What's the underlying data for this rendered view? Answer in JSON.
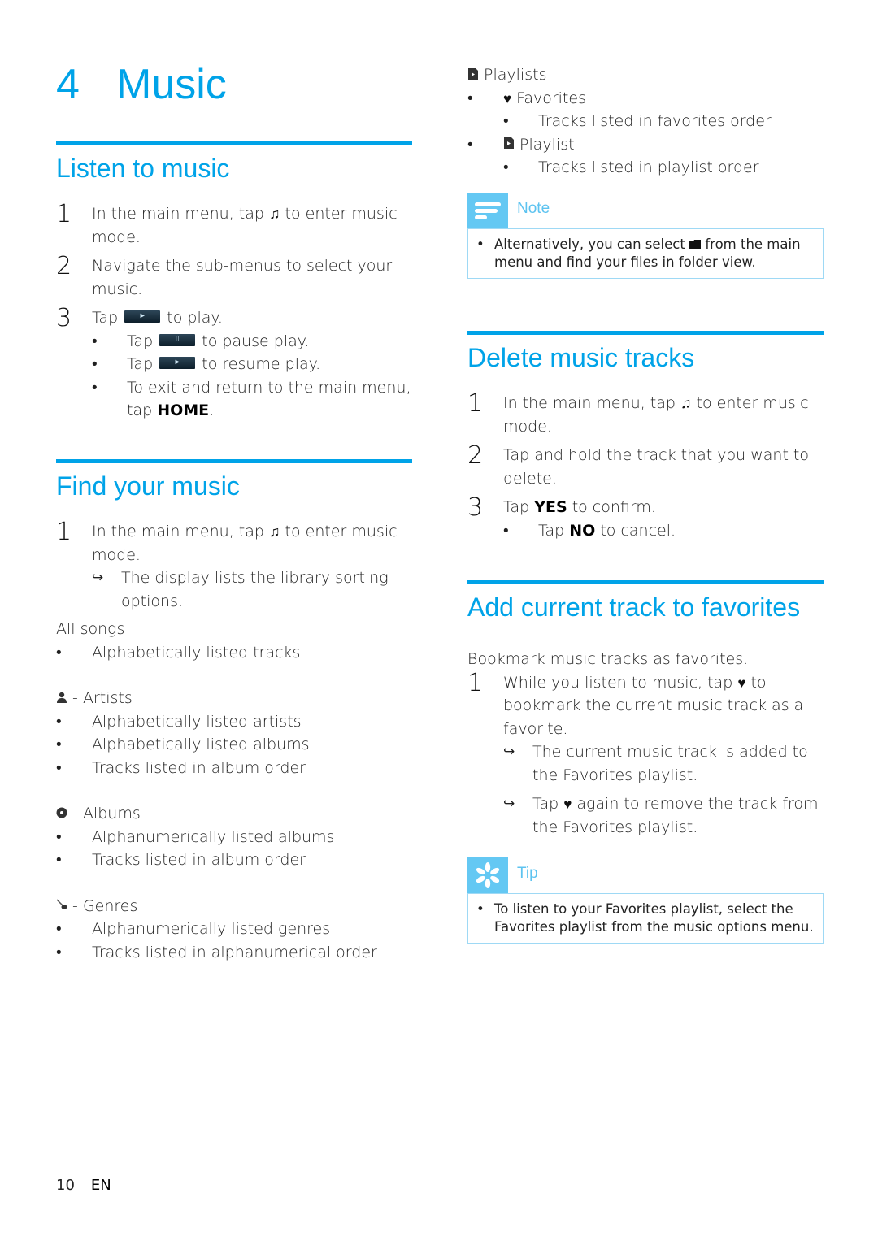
{
  "chapter": {
    "number": "4",
    "title": "Music"
  },
  "listen": {
    "heading": "Listen to music",
    "steps": [
      {
        "num": "1",
        "text_before": "In the main menu, tap",
        "text_after": "to enter music mode."
      },
      {
        "num": "2",
        "text": "Navigate the sub-menus to select your music."
      },
      {
        "num": "3",
        "text_before": "Tap",
        "text_after": "to play."
      }
    ],
    "bullets": [
      {
        "before": "Tap",
        "after": "to pause play."
      },
      {
        "before": "Tap",
        "after": "to resume play."
      },
      {
        "before": "To exit and return to the main menu, tap",
        "bold": "HOME",
        "after": "."
      }
    ]
  },
  "find": {
    "heading": "Find your music",
    "step1": {
      "num": "1",
      "text_before": "In the main menu, tap",
      "text_after": "to enter music mode."
    },
    "result": "The display lists the library sorting options.",
    "groups": [
      {
        "title": "All songs",
        "items": [
          "Alphabetically listed tracks"
        ]
      },
      {
        "title": "- Artists",
        "icon": "artist-icon",
        "items": [
          "Alphabetically listed artists",
          "Alphabetically listed albums",
          "Tracks listed in album order"
        ]
      },
      {
        "title": "- Albums",
        "icon": "album-icon",
        "items": [
          "Alphanumerically listed albums",
          "Tracks listed in album order"
        ]
      },
      {
        "title": "- Genres",
        "icon": "genre-icon",
        "items": [
          "Alphanumerically listed genres",
          "Tracks listed in alphanumerical order"
        ]
      }
    ]
  },
  "playlists": {
    "title": "Playlists",
    "favorites": {
      "label": "Favorites",
      "sub": "Tracks listed in favorites order"
    },
    "playlist": {
      "label": "Playlist",
      "sub": "Tracks listed in playlist order"
    }
  },
  "note": {
    "label": "Note",
    "text_before": "Alternatively, you can select",
    "text_after": "from the main menu and find your files in folder view."
  },
  "delete": {
    "heading": "Delete music tracks",
    "step1": {
      "num": "1",
      "text_before": "In the main menu, tap",
      "text_after": "to enter music mode."
    },
    "step2": {
      "num": "2",
      "text": "Tap and hold the track that you want to delete."
    },
    "step3": {
      "num": "3",
      "before": "Tap",
      "bold": "YES",
      "after": "to confirm."
    },
    "bullet": {
      "before": "Tap",
      "bold": "NO",
      "after": "to cancel."
    }
  },
  "favorites": {
    "heading": "Add current track to favorites",
    "intro": "Bookmark music tracks as favorites.",
    "step1": {
      "num": "1",
      "text_before": "While you listen to music, tap",
      "text_after": "to bookmark the current music track as a favorite."
    },
    "result1": "The current music track is added to the Favorites playlist.",
    "result2": {
      "before": "Tap",
      "after": "again to remove the track from the Favorites playlist."
    }
  },
  "tip": {
    "label": "Tip",
    "text": "To listen to your Favorites playlist, select the Favorites playlist from the music options menu."
  },
  "footer": {
    "page": "10",
    "lang": "EN"
  },
  "glyphs": {
    "bullet": "•",
    "arrow": "↪",
    "note": "♫",
    "play": "►",
    "pause": "II",
    "heart": "♥"
  },
  "colors": {
    "accent": "#00a3e8",
    "box_tab": "#64c8f3",
    "box_border": "#9ed9f5"
  }
}
